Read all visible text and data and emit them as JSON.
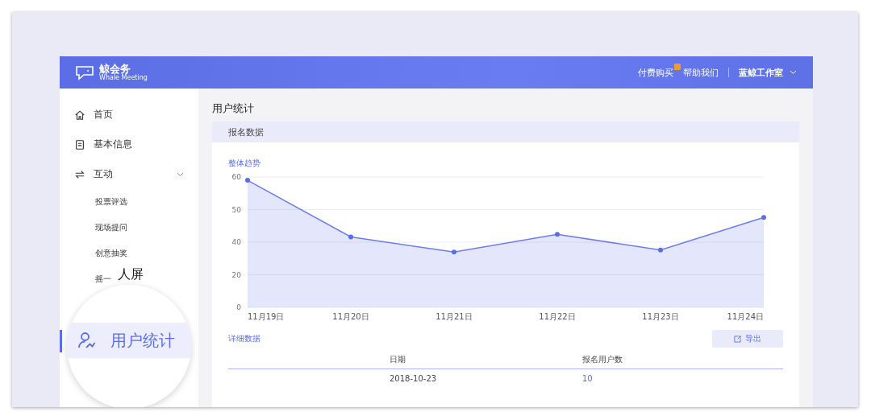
{
  "header": {
    "logo_name": "鲸会务",
    "logo_sub": "Whale Meeting",
    "links": [
      {
        "label": "付费购买",
        "badge": true
      },
      {
        "label": "帮助我们",
        "badge": false
      }
    ],
    "user": "蓝鲸工作室"
  },
  "sidebar": {
    "items": [
      {
        "label": "首页",
        "selected": false
      },
      {
        "label": "基本信息",
        "selected": false
      },
      {
        "label": "互动",
        "selected": false,
        "expanded": true,
        "children": [
          {
            "label": "投票评选",
            "selected": false
          },
          {
            "label": "现场提问",
            "selected": false
          },
          {
            "label": "创意抽奖",
            "selected": false
          },
          {
            "label": "摇一",
            "selected": false
          }
        ]
      }
    ]
  },
  "magnifier": {
    "fragment": "人屏",
    "label": "用户统计",
    "selected": true
  },
  "page_title": "用户统计",
  "card": {
    "title": "报名数据",
    "chart_title": "整体趋势",
    "trend_chart": {
      "y_labels": [
        "60",
        "50",
        "40",
        "20",
        "0"
      ],
      "x_labels": [
        "11月19日",
        "11月20日",
        "11月21日",
        "11月22日",
        "11月23日",
        "11月24日"
      ]
    },
    "detail_title": "详细数据",
    "export_label": "导出",
    "table": {
      "columns": [
        "日期",
        "报名用户数"
      ],
      "rows": [
        [
          "2018-10-23",
          "10"
        ]
      ]
    }
  }
}
